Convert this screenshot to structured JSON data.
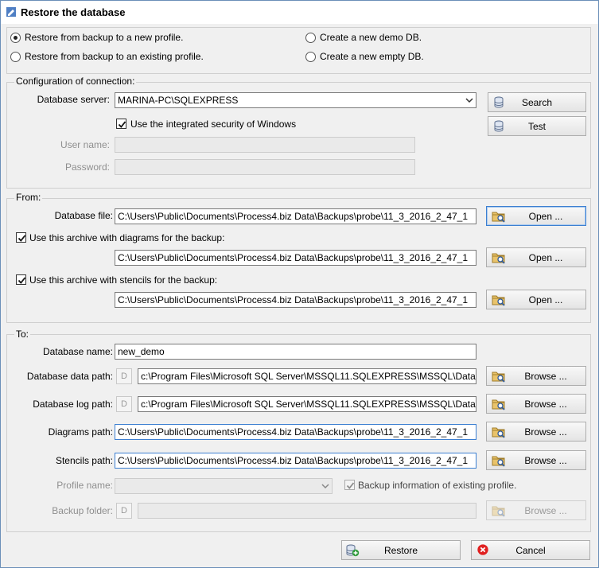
{
  "window": {
    "title": "Restore the database"
  },
  "mode": {
    "options": [
      "Restore from backup to a new profile.",
      "Restore from backup to an existing profile.",
      "Create a new demo DB.",
      "Create a new empty DB."
    ],
    "selected": "Restore from backup to a new profile."
  },
  "connection": {
    "group_label": "Configuration of connection:",
    "server_label": "Database server:",
    "server_value": "MARINA-PC\\SQLEXPRESS",
    "integrated_label": "Use the integrated security of Windows",
    "integrated_checked": true,
    "user_label": "User name:",
    "user_value": "",
    "password_label": "Password:",
    "password_value": "",
    "search_button": "Search",
    "test_button": "Test"
  },
  "from": {
    "group_label": "From:",
    "db_file_label": "Database file:",
    "db_file_value": "C:\\Users\\Public\\Documents\\Process4.biz Data\\Backups\\probe\\11_3_2016_2_47_1",
    "diagrams_check_label": "Use this archive with diagrams for the backup:",
    "diagrams_checked": true,
    "diagrams_value": "C:\\Users\\Public\\Documents\\Process4.biz Data\\Backups\\probe\\11_3_2016_2_47_1",
    "stencils_check_label": "Use this archive with stencils for the backup:",
    "stencils_checked": true,
    "stencils_value": "C:\\Users\\Public\\Documents\\Process4.biz Data\\Backups\\probe\\11_3_2016_2_47_1",
    "open_button": "Open ..."
  },
  "to": {
    "group_label": "To:",
    "db_name_label": "Database name:",
    "db_name_value": "new_demo",
    "data_path_label": "Database data path:",
    "data_path_value": "c:\\Program Files\\Microsoft SQL Server\\MSSQL11.SQLEXPRESS\\MSSQL\\Data",
    "log_path_label": "Database log path:",
    "log_path_value": "c:\\Program Files\\Microsoft SQL Server\\MSSQL11.SQLEXPRESS\\MSSQL\\Data",
    "diagrams_path_label": "Diagrams path:",
    "diagrams_path_value": "C:\\Users\\Public\\Documents\\Process4.biz Data\\Backups\\probe\\11_3_2016_2_47_1",
    "stencils_path_label": "Stencils path:",
    "stencils_path_value": "C:\\Users\\Public\\Documents\\Process4.biz Data\\Backups\\probe\\11_3_2016_2_47_1",
    "profile_name_label": "Profile name:",
    "profile_name_value": "",
    "backup_info_label": "Backup information of existing profile.",
    "backup_info_checked": true,
    "backup_folder_label": "Backup folder:",
    "backup_folder_value": "",
    "d_button": "D",
    "browse_button": "Browse ..."
  },
  "footer": {
    "restore_button": "Restore",
    "cancel_button": "Cancel"
  },
  "colors": {
    "accent_focus": "#3c7fd1",
    "cancel_icon": "#e02020",
    "restore_icon": "#2e9a3a"
  }
}
